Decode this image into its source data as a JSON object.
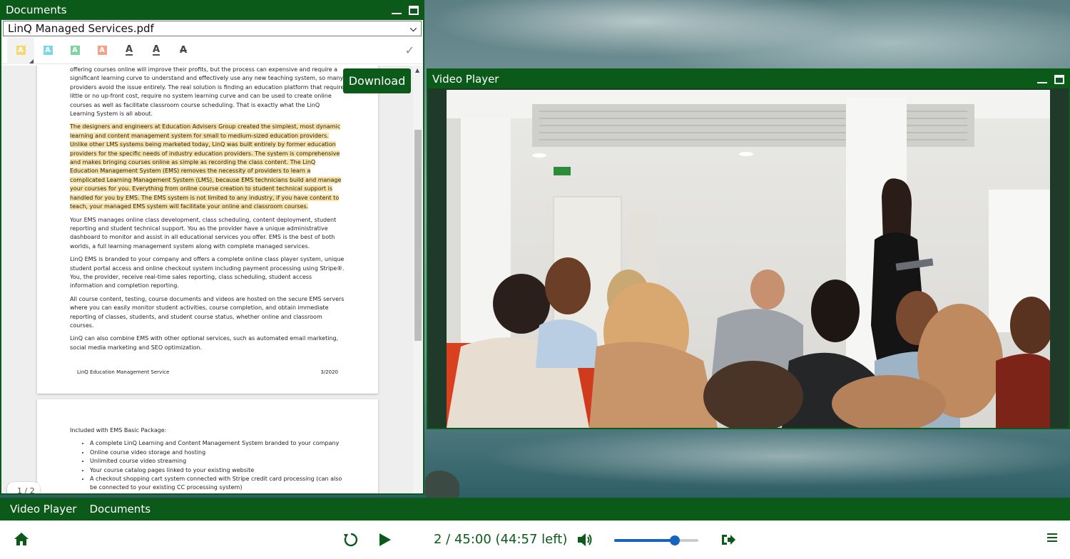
{
  "documents_window": {
    "title": "Documents",
    "selected_file": "LinQ Managed Services.pdf",
    "download_label": "Download",
    "page_indicator": "1 / 2",
    "toolbar": {
      "tools": [
        {
          "name": "highlight-yellow-icon",
          "glyph": "A",
          "color": "#f7d774"
        },
        {
          "name": "highlight-cyan-icon",
          "glyph": "A",
          "color": "#7fd6e6"
        },
        {
          "name": "highlight-green-icon",
          "glyph": "A",
          "color": "#7ed3a0"
        },
        {
          "name": "highlight-red-icon",
          "glyph": "A",
          "color": "#f0a38a"
        },
        {
          "name": "underline-icon",
          "glyph": "A"
        },
        {
          "name": "squiggly-underline-icon",
          "glyph": "A"
        },
        {
          "name": "strikethrough-icon",
          "glyph": "A"
        }
      ],
      "confirm_glyph": "✓"
    },
    "page1": {
      "para0": "offering courses online will improve their profits, but the process can expensive and require a significant learning curve to understand and effectively use any new teaching system, so many providers avoid the issue entirely.  The real solution is finding an education platform that require little or no up-front cost, require no system learning curve and can be used to create online courses as well as facilitate classroom course scheduling.  That is exactly what the LinQ Learning System is all about.",
      "para1": "The designers and engineers at Education Advisers Group created the simplest, most dynamic learning and content management system for small to medium-sized education providers.  Unlike other LMS systems being marketed today, LinQ was built entirely by former education providers for the specific needs of industry education providers.  The system is comprehensive and makes bringing courses online as simple as recording the class content.  The LinQ Education Management System (EMS) removes the necessity of providers to learn a complicated Learning Management System (LMS), because EMS technicians build and manage your courses for you.  Everything from online course creation to student technical support is handled for you by EMS.  The EMS system is not limited to any industry, if you have content to teach, your managed EMS system will facilitate your online and classroom courses.",
      "para2": "Your EMS manages online class development, class scheduling, content deployment, student reporting and student technical support.  You as the provider have a unique administrative dashboard to monitor and assist in all educational services you offer.  EMS is the best of both worlds, a full learning management system along with complete managed services.",
      "para3": "LinQ EMS is branded to your company and offers a complete online class player system, unique student portal access and online checkout system including payment processing using Stripe®.  You, the provider, receive real-time sales reporting, class scheduling, student access information and completion reporting.",
      "para4": "All course content, testing, course documents and videos are hosted on the secure EMS servers where you can easily monitor student activities, course completion, and obtain immediate reporting of classes, students, and student course status, whether online and classroom courses.",
      "para5": "LinQ can also combine EMS with other optional services, such as automated email marketing, social media marketing and SEO optimization.",
      "footer_left": "LinQ Education Management Service",
      "footer_right": "3/2020"
    },
    "page2": {
      "intro": "Included with EMS Basic Package:",
      "items": [
        "A complete LinQ Learning and Content Management System branded to your company",
        "Online course video storage and hosting",
        "Unlimited course video streaming",
        "Your course catalog pages linked to your existing website",
        "A checkout shopping cart system connected with Stripe credit card processing (can also be connected to your existing CC processing system)"
      ]
    }
  },
  "video_window": {
    "title": "Video Player"
  },
  "tabs": [
    "Video Player",
    "Documents"
  ],
  "controls": {
    "time_text": "2 / 45:00 (44:57 left)",
    "volume_fraction": 0.72
  }
}
